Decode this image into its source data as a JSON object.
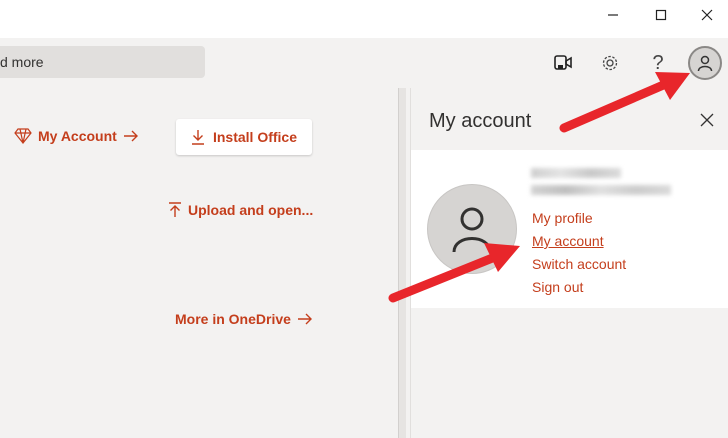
{
  "window": {
    "minimize_icon": "minimize-icon",
    "maximize_icon": "maximize-icon",
    "close_icon": "close-icon"
  },
  "header": {
    "search_text": "d more",
    "icons": [
      "teams-meet-icon",
      "gear-icon",
      "help-icon",
      "avatar-icon"
    ],
    "help_glyph": "?"
  },
  "main": {
    "my_account_link": "My Account",
    "install_office": "Install Office",
    "upload_open": "Upload and open...",
    "more_onedrive": "More in OneDrive"
  },
  "panel": {
    "title": "My account",
    "links": {
      "my_profile": "My profile",
      "my_account": "My account",
      "switch_account": "Switch account",
      "sign_out": "Sign out"
    }
  },
  "colors": {
    "accent": "#c43e1c",
    "arrow": "#e8262b",
    "background": "#f3f2f1"
  }
}
